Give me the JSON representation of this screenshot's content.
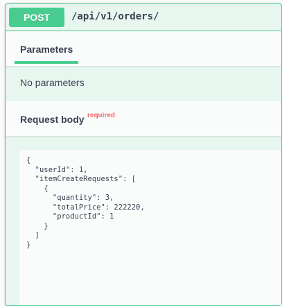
{
  "operation": {
    "method": "POST",
    "path": "/api/v1/orders/",
    "method_color": "#49cc90"
  },
  "tabs": [
    {
      "label": "Parameters",
      "active": true
    }
  ],
  "parameters": {
    "empty_text": "No parameters"
  },
  "request_body": {
    "title": "Request body",
    "required_label": "required",
    "value": "{\n  \"userId\": 1,\n  \"itemCreateRequests\": [\n    {\n      \"quantity\": 3,\n      \"totalPrice\": 222220,\n      \"productId\": 1\n    }\n  ]\n}"
  }
}
